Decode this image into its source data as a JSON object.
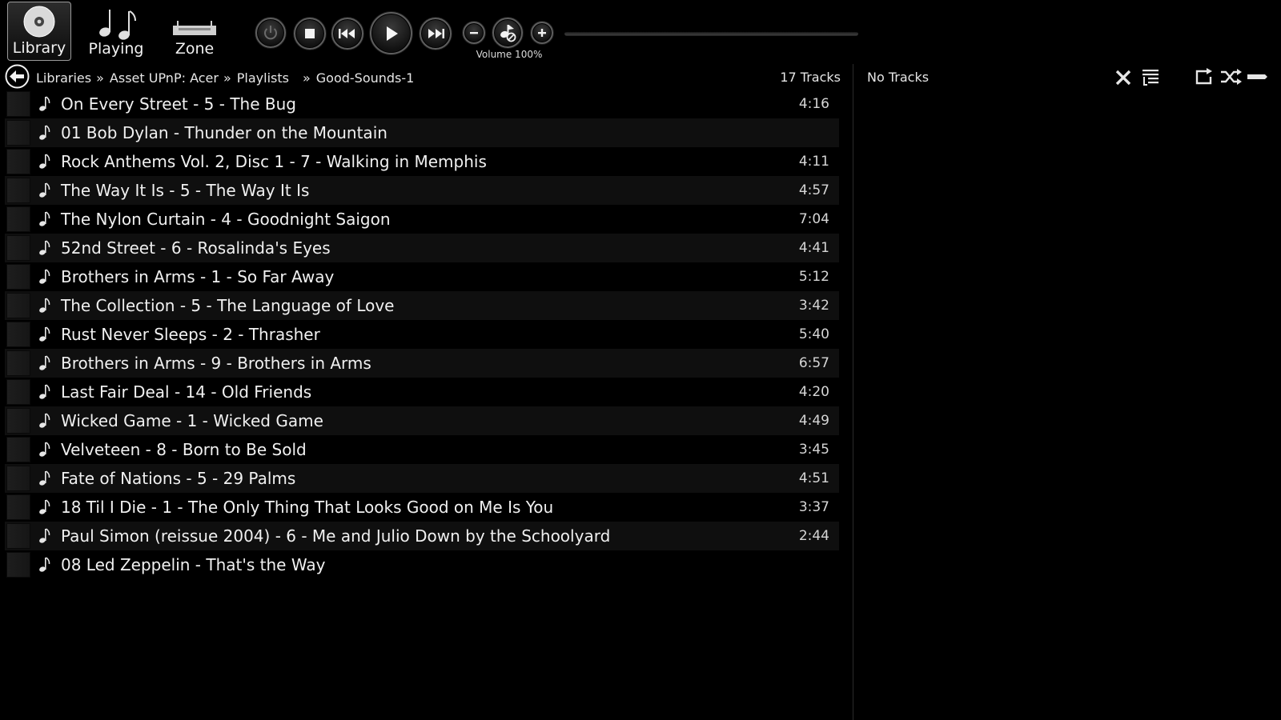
{
  "nav": {
    "library": "Library",
    "playing": "Playing",
    "zone": "Zone"
  },
  "transport": {
    "volume_label": "Volume 100%",
    "icons": [
      "power-icon",
      "stop-icon",
      "previous-icon",
      "play-icon",
      "next-icon",
      "volume-down-icon",
      "mute-icon",
      "volume-up-icon"
    ]
  },
  "breadcrumb": {
    "items": [
      "Libraries",
      "Asset UPnP: Acer",
      "Playlists",
      "Good-Sounds-1"
    ],
    "separator": "»"
  },
  "tracks_count": "17 Tracks",
  "tracks": [
    {
      "title": "On Every Street - 5 - The Bug",
      "duration": "4:16"
    },
    {
      "title": "01 Bob Dylan - Thunder on the Mountain",
      "duration": ""
    },
    {
      "title": "Rock Anthems Vol. 2, Disc 1 - 7 - Walking in Memphis",
      "duration": "4:11"
    },
    {
      "title": "The Way It Is - 5 - The Way It Is",
      "duration": "4:57"
    },
    {
      "title": "The Nylon Curtain - 4 - Goodnight Saigon",
      "duration": "7:04"
    },
    {
      "title": "52nd Street - 6 - Rosalinda's Eyes",
      "duration": "4:41"
    },
    {
      "title": "Brothers in Arms - 1 - So Far Away",
      "duration": "5:12"
    },
    {
      "title": "The Collection - 5 - The Language of Love",
      "duration": "3:42"
    },
    {
      "title": "Rust Never Sleeps - 2 - Thrasher",
      "duration": "5:40"
    },
    {
      "title": "Brothers in Arms - 9 - Brothers in Arms",
      "duration": "6:57"
    },
    {
      "title": "Last Fair Deal - 14 - Old Friends",
      "duration": "4:20"
    },
    {
      "title": "Wicked Game - 1 - Wicked Game",
      "duration": "4:49"
    },
    {
      "title": "Velveteen - 8 - Born to Be Sold",
      "duration": "3:45"
    },
    {
      "title": "Fate of Nations - 5 - 29 Palms",
      "duration": "4:51"
    },
    {
      "title": "18 Til I Die - 1 - The Only Thing That Looks Good on Me Is You",
      "duration": "3:37"
    },
    {
      "title": "Paul Simon (reissue 2004) - 6 - Me and Julio Down by the Schoolyard",
      "duration": "2:44"
    },
    {
      "title": "08 Led Zeppelin - That's the Way",
      "duration": ""
    }
  ],
  "queue": {
    "empty_label": "No Tracks",
    "tool_icons": [
      "clear-icon",
      "queue-list-icon",
      "repeat-icon",
      "shuffle-icon",
      "dash-icon"
    ]
  },
  "colors": {
    "background": "#000000",
    "row_alt": "#0f0f0f",
    "text": "#f0f0f0"
  }
}
